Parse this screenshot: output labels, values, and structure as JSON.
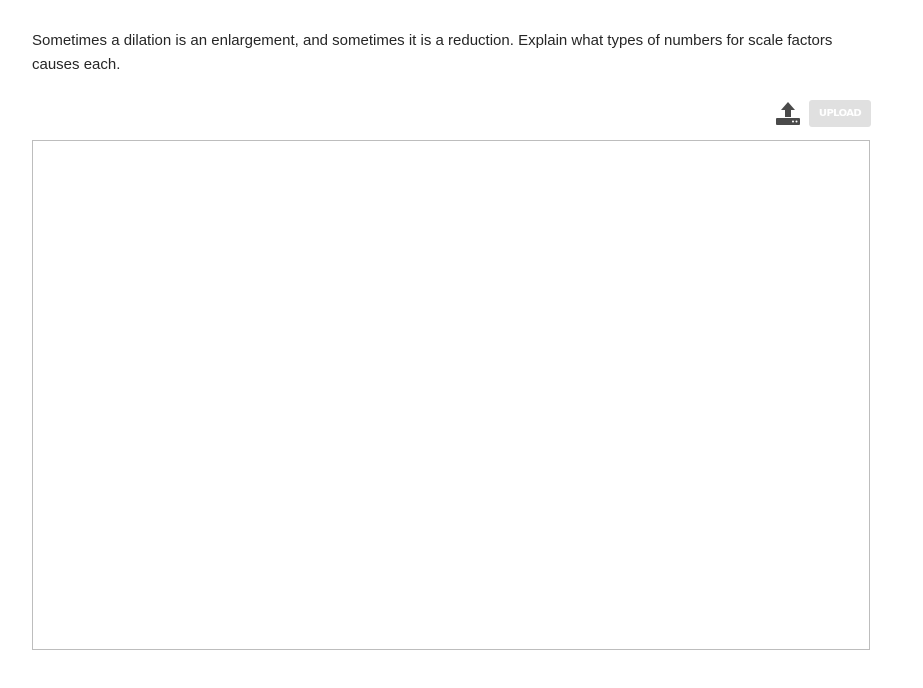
{
  "question": {
    "text": "Sometimes a dilation is an enlargement, and sometimes it is a reduction. Explain what types of numbers for scale factors causes each."
  },
  "toolbar": {
    "upload_icon": "upload-tray-icon",
    "upload_label": "UPLOAD",
    "upload_enabled": false
  },
  "answer": {
    "value": "",
    "placeholder": ""
  },
  "colors": {
    "icon": "#4a4a4a",
    "button_disabled_bg": "#e0e0e0",
    "button_text": "#ffffff",
    "border": "#bdbdbd"
  }
}
